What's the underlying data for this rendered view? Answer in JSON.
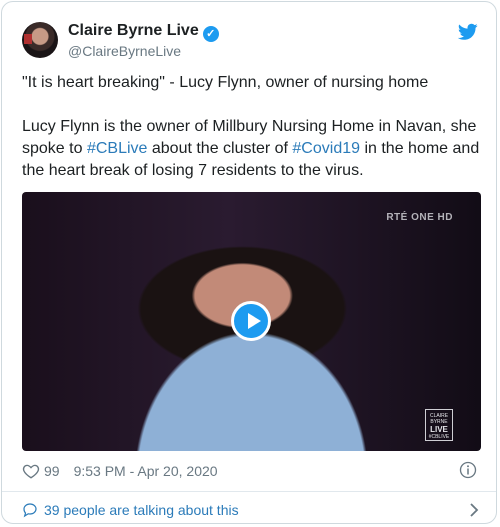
{
  "author": {
    "name": "Claire Byrne Live",
    "handle": "@ClaireByrneLive",
    "verified": true
  },
  "tweet": {
    "quote_line": "\"It is heart breaking\" - Lucy Flynn, owner of nursing home",
    "body_part1": "Lucy Flynn is the owner of Millbury Nursing Home in Navan, she spoke to ",
    "hashtag1": "#CBLive",
    "body_part2": " about the cluster of ",
    "hashtag2": "#Covid19",
    "body_part3": " in the home and the heart break of losing 7 residents to the virus."
  },
  "media": {
    "channel_watermark": "RTÉ ONE HD",
    "show_logo_line1": "CLAIRE",
    "show_logo_line2": "BYRNE",
    "show_logo_line3": "LIVE",
    "show_logo_line4": "#CBLIVE"
  },
  "footer": {
    "like_count": "99",
    "timestamp": "9:53 PM - Apr 20, 2020",
    "conversation": "39 people are talking about this"
  },
  "colors": {
    "accent": "#1d9bf0",
    "link": "#2b7bb9",
    "muted": "#697882"
  },
  "icons": [
    "twitter-bird-icon",
    "verified-badge-icon",
    "play-icon",
    "heart-icon",
    "info-icon",
    "speech-bubble-icon",
    "chevron-right-icon"
  ]
}
